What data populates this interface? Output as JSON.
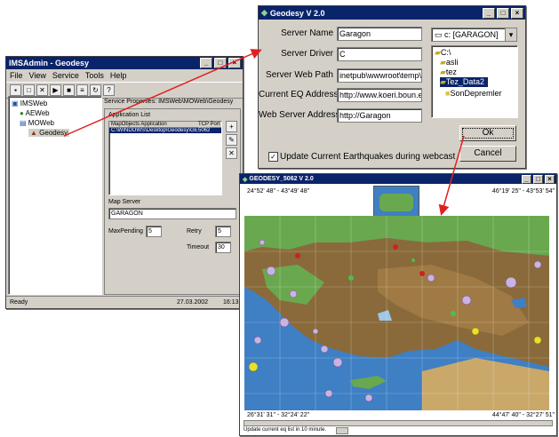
{
  "ims": {
    "title": "IMSAdmin - Geodesy",
    "menu": [
      "File",
      "View",
      "Service",
      "Tools",
      "Help"
    ],
    "tree": [
      "IMSWeb",
      "AEWeb",
      "MOWeb",
      "Geodesy"
    ],
    "service_props": "Service Properties: IMSWeb\\MOWeb\\Geodesy",
    "app_list_label": "Application List",
    "col_app": "MapObjects Application",
    "col_port": "TCP Port",
    "row_app": "C:\\WINDOWS\\Desktop\\Geodesy\\GEOD",
    "row_port": "5062",
    "map_server_label": "Map Server",
    "map_server_value": "GARAGON",
    "max_pending_label": "MaxPending",
    "max_pending_value": "5",
    "retry_label": "Retry",
    "retry_value": "5",
    "timeout_label": "Timeout",
    "timeout_value": "30",
    "status_ready": "Ready",
    "status_date": "27.03.2002",
    "status_time": "16:13"
  },
  "dialog": {
    "title": "Geodesy V 2.0",
    "server_name_label": "Server Name",
    "server_name_value": "Garagon",
    "server_driver_label": "Server Driver",
    "server_driver_value": "C",
    "web_path_label": "Server Web Path",
    "web_path_value": "inetpub\\wwwroot\\temp\\",
    "eq_address_label": "Current EQ Address",
    "eq_address_value": "http://www.koeri.boun.e",
    "web_server_label": "Web Server Address",
    "web_server_value": "http://Garagon",
    "drive_select": "c: [GARAGON]",
    "folders": [
      "C:\\",
      "asli",
      "tez",
      "Tez_Data2",
      "SonDepremler"
    ],
    "ok_label": "Ok",
    "cancel_label": "Cancel",
    "update_label": "Update Current Earthquakes during webcast"
  },
  "map": {
    "title": "GEODESY_5062 V 2.0",
    "coord_tl": "24°52' 48\" - 43°49' 48\"",
    "coord_tr": "46°19' 25\" - 43°53' 54\"",
    "coord_bl": "26°31' 31\" - 32°24' 22\"",
    "coord_br": "44°47' 40\" - 32°27' 51\"",
    "status_text": "Update current eq list in 10 minute.",
    "colors": {
      "land": "#8a6a3a",
      "sea": "#3f7fc4",
      "green": "#6aa84f",
      "quake": "#c9b3e0"
    }
  }
}
